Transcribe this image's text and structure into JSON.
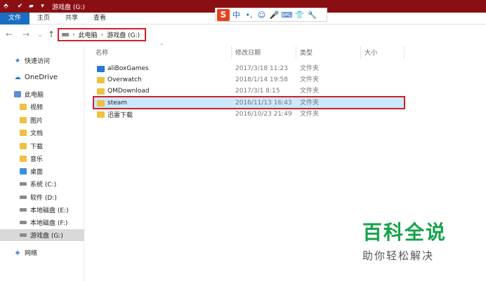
{
  "window": {
    "title": "游戏盘 (G:)"
  },
  "ribbon": {
    "tabs": [
      {
        "label": "文件"
      },
      {
        "label": "主页"
      },
      {
        "label": "共享"
      },
      {
        "label": "查看"
      }
    ]
  },
  "ime": {
    "logo": "S",
    "items": [
      "中",
      "•,",
      "☺",
      "🎤",
      "⌨",
      "👕",
      "🔧"
    ]
  },
  "address": {
    "segments": [
      "此电脑",
      "游戏盘 (G:)"
    ]
  },
  "sidebar": {
    "items": [
      {
        "label": "快速访问"
      },
      {
        "label": "OneDrive"
      },
      {
        "label": "此电脑"
      },
      {
        "label": "视频"
      },
      {
        "label": "图片"
      },
      {
        "label": "文档"
      },
      {
        "label": "下载"
      },
      {
        "label": "音乐"
      },
      {
        "label": "桌面"
      },
      {
        "label": "系统 (C:)"
      },
      {
        "label": "软件 (D:)"
      },
      {
        "label": "本地磁盘 (E:)"
      },
      {
        "label": "本地磁盘 (F:)"
      },
      {
        "label": "游戏盘 (G:)"
      },
      {
        "label": "网络"
      }
    ]
  },
  "columns": {
    "name": "名称",
    "date": "修改日期",
    "type": "类型",
    "size": "大小"
  },
  "files": [
    {
      "name": "aliBoxGames",
      "date": "2017/3/18 11:23",
      "type": "文件夹"
    },
    {
      "name": "Overwatch",
      "date": "2018/1/14 19:58",
      "type": "文件夹"
    },
    {
      "name": "QMDownload",
      "date": "2017/3/1 8:15",
      "type": "文件夹"
    },
    {
      "name": "steam",
      "date": "2016/11/13 16:43",
      "type": "文件夹"
    },
    {
      "name": "迅雷下载",
      "date": "2016/10/23 21:49",
      "type": "文件夹"
    }
  ],
  "watermark": {
    "title": "百科全说",
    "subtitle": "助你轻松解决"
  },
  "colors": {
    "titlebar": "#8a0f13",
    "file_tab": "#1a6fc4",
    "highlight_border": "#d32029",
    "selection": "#cce8ff",
    "watermark_green": "#16a34a"
  }
}
